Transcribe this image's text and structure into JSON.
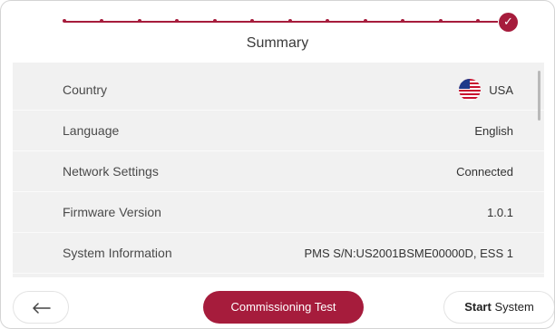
{
  "page": {
    "title": "Summary"
  },
  "progress": {
    "completed": true,
    "icon": "check-icon"
  },
  "summary": {
    "rows": [
      {
        "label": "Country",
        "value": "USA",
        "icon": "usa-flag-icon"
      },
      {
        "label": "Language",
        "value": "English"
      },
      {
        "label": "Network Settings",
        "value": "Connected"
      },
      {
        "label": "Firmware Version",
        "value": "1.0.1"
      },
      {
        "label": "System Information",
        "value": "PMS S/N:US2001BSME00000D, ESS 1"
      }
    ]
  },
  "footer": {
    "back_icon": "arrow-left-icon",
    "commissioning_bold": "Commissioning",
    "commissioning_rest": " Test",
    "start_bold": "Start",
    "start_rest": " System"
  },
  "colors": {
    "accent": "#a61c3c",
    "panel": "#f1f1f1"
  }
}
